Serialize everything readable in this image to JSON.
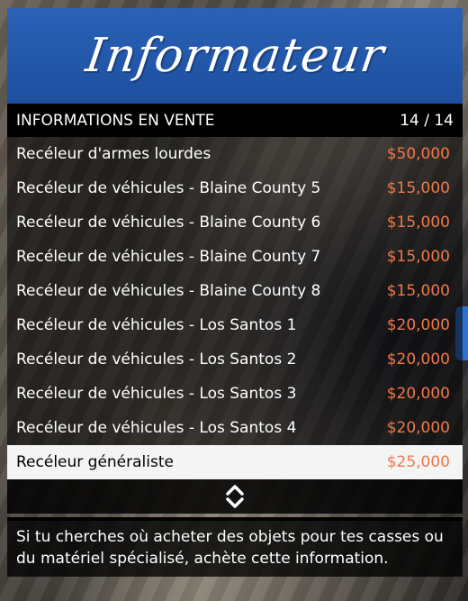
{
  "banner": {
    "title": "Informateur"
  },
  "subheader": {
    "label": "INFORMATIONS EN VENTE",
    "counter": "14 / 14"
  },
  "items": [
    {
      "label": "Recéleur d'armes lourdes",
      "price": "$50,000"
    },
    {
      "label": "Recéleur de véhicules - Blaine County 5",
      "price": "$15,000"
    },
    {
      "label": "Recéleur de véhicules - Blaine County 6",
      "price": "$15,000"
    },
    {
      "label": "Recéleur de véhicules - Blaine County 7",
      "price": "$15,000"
    },
    {
      "label": "Recéleur de véhicules - Blaine County 8",
      "price": "$15,000"
    },
    {
      "label": "Recéleur de véhicules - Los Santos 1",
      "price": "$20,000"
    },
    {
      "label": "Recéleur de véhicules - Los Santos 2",
      "price": "$20,000"
    },
    {
      "label": "Recéleur de véhicules - Los Santos 3",
      "price": "$20,000"
    },
    {
      "label": "Recéleur de véhicules - Los Santos 4",
      "price": "$20,000"
    },
    {
      "label": "Recéleur généraliste",
      "price": "$25,000",
      "selected": true
    }
  ],
  "description": "Si tu cherches où acheter des objets pour tes casses ou du matériel spécialisé, achète cette information.",
  "colors": {
    "banner": "#2a61b6",
    "price": "#f07848",
    "selected_row": "#f4f4f4"
  },
  "icons": {
    "navigation": "up-down-chevron-icon"
  }
}
